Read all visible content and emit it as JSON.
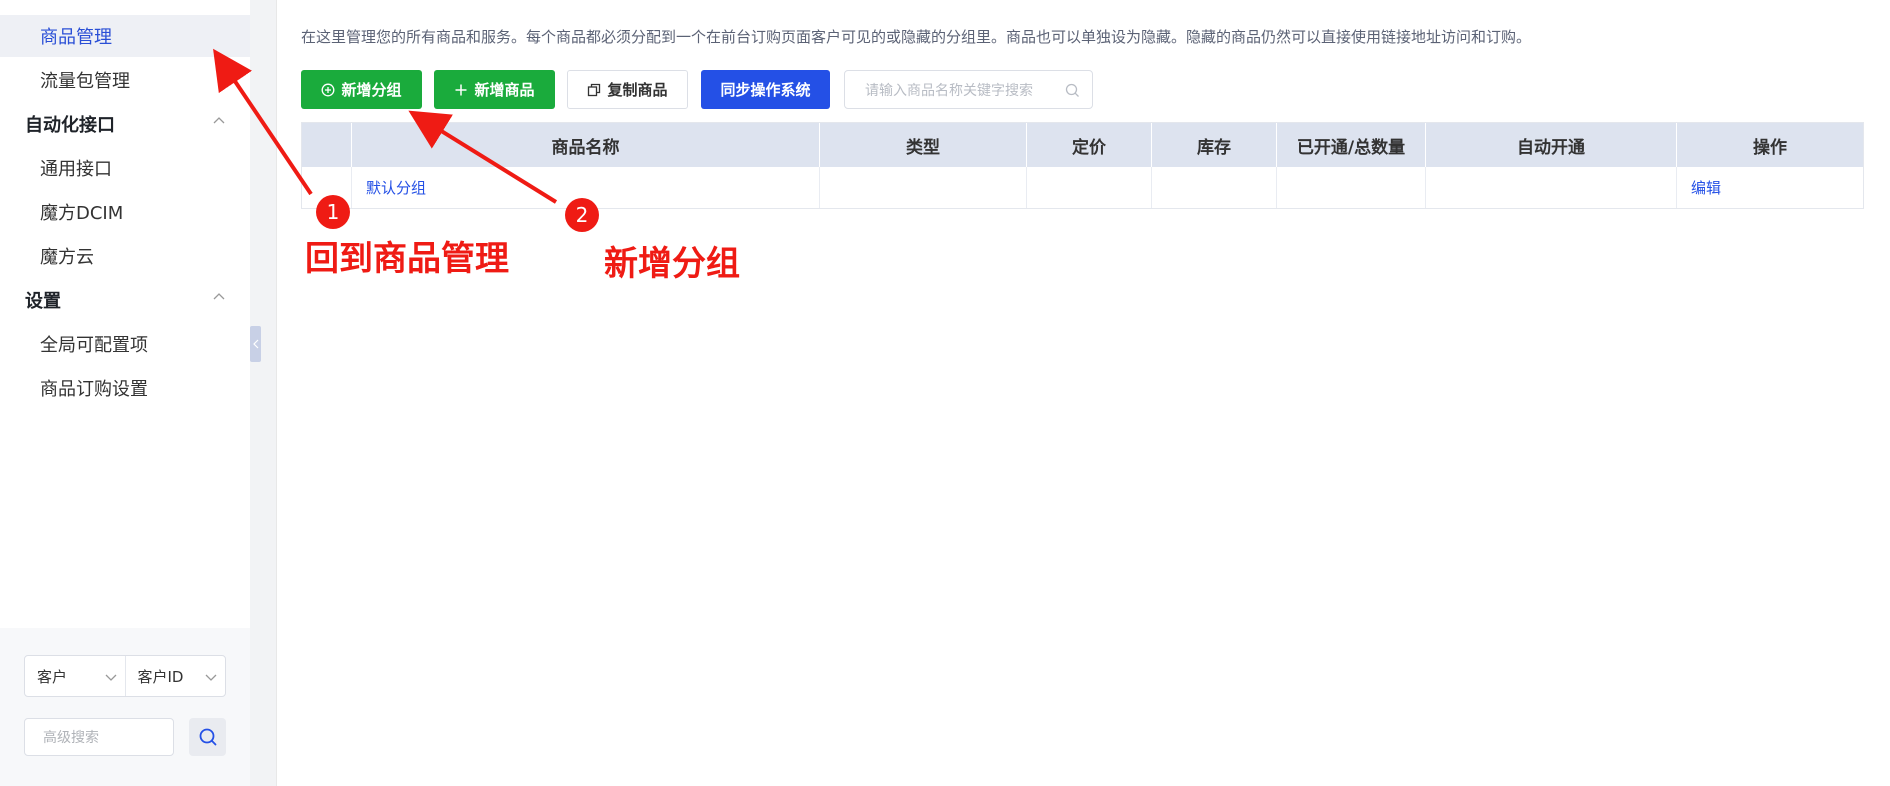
{
  "sidebar": {
    "items": [
      {
        "label": "商品管理",
        "type": "sub",
        "active": true
      },
      {
        "label": "流量包管理",
        "type": "sub"
      },
      {
        "label": "自动化接口",
        "type": "group"
      },
      {
        "label": "通用接口",
        "type": "sub"
      },
      {
        "label": "魔方DCIM",
        "type": "sub"
      },
      {
        "label": "魔方云",
        "type": "sub"
      },
      {
        "label": "设置",
        "type": "group"
      },
      {
        "label": "全局可配置项",
        "type": "sub"
      },
      {
        "label": "商品订购设置",
        "type": "sub"
      }
    ],
    "filter": {
      "select1": "客户",
      "select2": "客户ID",
      "advanced_placeholder": "高级搜索"
    }
  },
  "main": {
    "description": "在这里管理您的所有商品和服务。每个商品都必须分配到一个在前台订购页面客户可见的或隐藏的分组里。商品也可以单独设为隐藏。隐藏的商品仍然可以直接使用链接地址访问和订购。",
    "toolbar": {
      "add_group": "新增分组",
      "add_product": "新增商品",
      "copy_product": "复制商品",
      "sync_os": "同步操作系统",
      "search_placeholder": "请输入商品名称关键字搜索"
    },
    "table": {
      "headers": [
        "",
        "商品名称",
        "类型",
        "定价",
        "库存",
        "已开通/总数量",
        "自动开通",
        "操作"
      ],
      "rows": [
        {
          "name": "默认分组",
          "type": "",
          "price": "",
          "stock": "",
          "opened": "",
          "auto": "",
          "action": "编辑"
        }
      ]
    }
  },
  "annotations": {
    "badge1": "1",
    "label1": "回到商品管理",
    "badge2": "2",
    "label2": "新增分组",
    "color": "#ef1b14"
  }
}
